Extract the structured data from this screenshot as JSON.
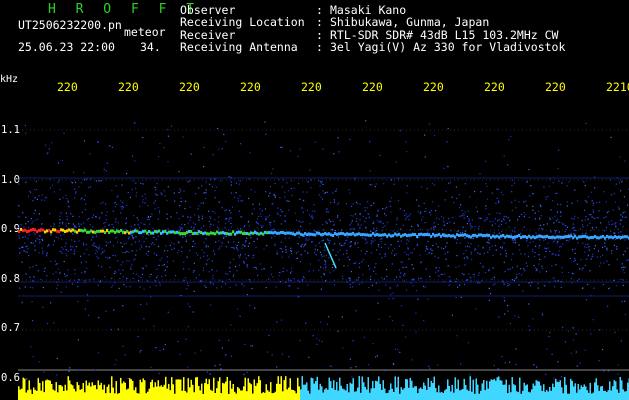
{
  "header": {
    "app_title": "H R O F F T",
    "filename": "UT2506232200.pn",
    "tag": "meteor",
    "datetime": "25.06.23 22:00",
    "count": "34."
  },
  "station": {
    "fields": [
      {
        "label": "Observer",
        "value": "Masaki Kano"
      },
      {
        "label": "Receiving Location",
        "value": "Shibukawa, Gunma, Japan"
      },
      {
        "label": "Receiver",
        "value": "RTL-SDR SDR# 43dB L15 103.2MHz CW"
      },
      {
        "label": "Receiving Antenna",
        "value": "3el Yagi(V) Az 330 for Vladivostok"
      }
    ]
  },
  "axes": {
    "freq_unit": "kHz",
    "freq_ticks": [
      "1.1",
      "1.0",
      "0.9",
      "0.8",
      "0.7",
      "0.6"
    ],
    "time_ticks": [
      "220",
      "220",
      "220",
      "220",
      "220",
      "220",
      "220",
      "220",
      "220",
      "2210"
    ]
  },
  "colors": {
    "background": "#000000",
    "title": "#2bd12b",
    "time_ticks": "#ffff00",
    "signal_low": "#1f3cff",
    "signal_high": "#ff2020",
    "meteor_echo": "#49e0ff",
    "level_bar_a": "#ffff00",
    "level_bar_b": "#3fd7ff"
  }
}
